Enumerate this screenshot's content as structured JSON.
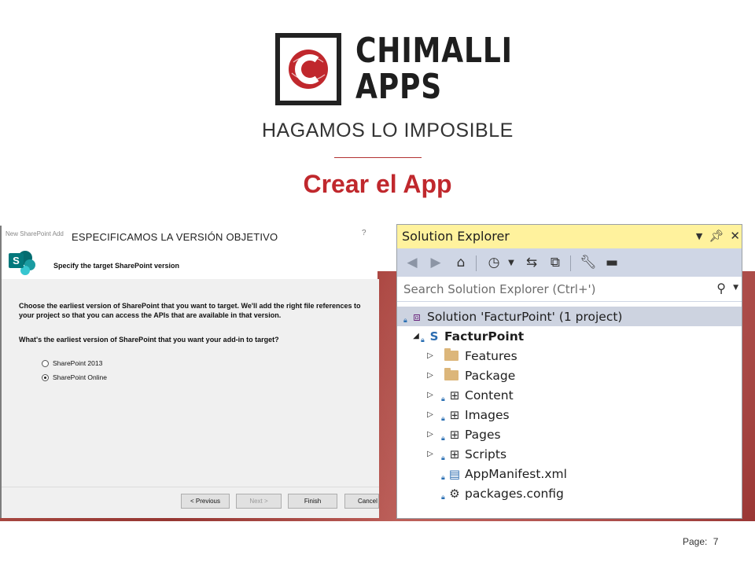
{
  "brand": {
    "line1": "CHIMALLI",
    "line2": "APPS",
    "tagline": "HAGAMOS LO IMPOSIBLE"
  },
  "slide": {
    "title": "Crear el App",
    "page_label": "Page:",
    "page_number": "7"
  },
  "dialog": {
    "caption": "New SharePoint Add",
    "overlay_label": "ESPECIFICAMOS LA VERSIÓN OBJETIVO",
    "help": "?",
    "heading": "Specify the target SharePoint version",
    "description": "Choose the earliest version of SharePoint that you want to target. We'll add the right file references to your project so that you can access the APIs that are available in that version.",
    "question": "What's the earliest version of SharePoint that you want your add-in to target?",
    "options": [
      {
        "label": "SharePoint 2013",
        "selected": false
      },
      {
        "label": "SharePoint Online",
        "selected": true
      }
    ],
    "buttons": {
      "previous": "< Previous",
      "next": "Next >",
      "finish": "Finish",
      "cancel": "Cancel"
    }
  },
  "solution_explorer": {
    "title": "Solution Explorer",
    "search_placeholder": "Search Solution Explorer (Ctrl+')",
    "tree": [
      {
        "label": "Solution 'FacturPoint' (1 project)",
        "icon": "solution-icon",
        "selected": true
      },
      {
        "label": "FacturPoint",
        "icon": "sharepoint-project-icon",
        "expanded": true
      },
      {
        "label": "Features",
        "icon": "folder-icon"
      },
      {
        "label": "Package",
        "icon": "folder-icon"
      },
      {
        "label": "Content",
        "icon": "module-icon"
      },
      {
        "label": "Images",
        "icon": "module-icon"
      },
      {
        "label": "Pages",
        "icon": "module-icon"
      },
      {
        "label": "Scripts",
        "icon": "module-icon"
      },
      {
        "label": "AppManifest.xml",
        "icon": "manifest-icon"
      },
      {
        "label": "packages.config",
        "icon": "config-icon"
      }
    ]
  },
  "colors": {
    "accent_red": "#c0282d",
    "se_title_bg": "#fff29d",
    "se_toolbar_bg": "#cfd6e5"
  }
}
